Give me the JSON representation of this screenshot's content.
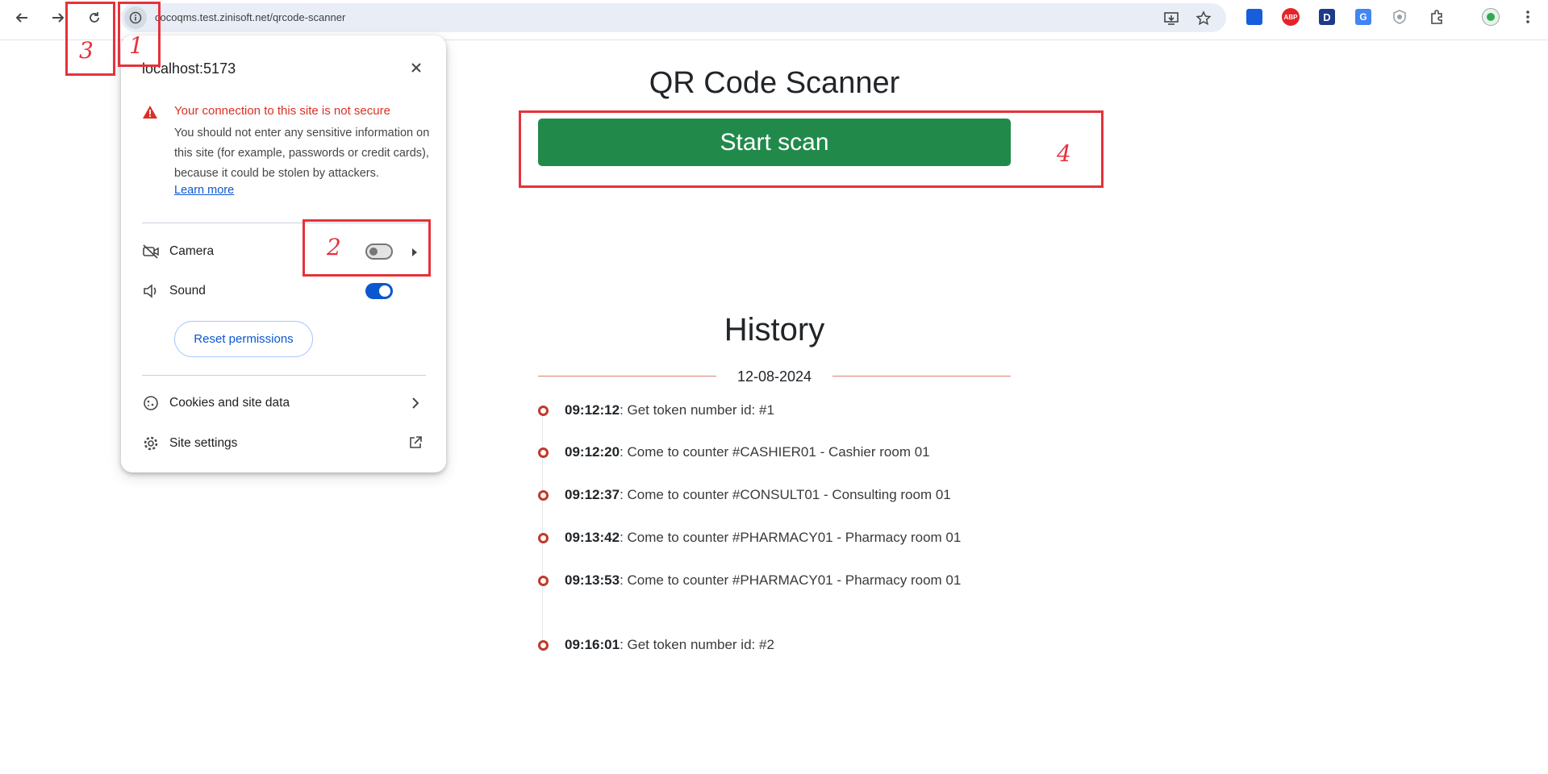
{
  "browser": {
    "url": "cocoqms.test.zinisoft.net/qrcode-scanner",
    "icons": [
      "back-icon",
      "forward-icon",
      "reload-icon",
      "site-info-icon",
      "install-app-icon",
      "bookmark-star-icon",
      "profile-avatar-icon",
      "more-menu-icon"
    ],
    "extensions": [
      {
        "name": "bitwarden-extension-icon",
        "label": "",
        "color": "#175ddc"
      },
      {
        "name": "adblock-plus-extension-icon",
        "label": "ABP",
        "color": "#e4232a"
      },
      {
        "name": "dashlane-extension-icon",
        "label": "D",
        "color": "#1e3a8a"
      },
      {
        "name": "translate-extension-icon",
        "label": "G",
        "color": "#4285f4"
      },
      {
        "name": "shield-extension-icon",
        "label": "",
        "color": "#9aa0a6"
      },
      {
        "name": "extensions-puzzle-icon",
        "label": "",
        "color": "#444746"
      }
    ]
  },
  "annotations": [
    "1",
    "2",
    "3",
    "4"
  ],
  "site_info_popup": {
    "title": "localhost:5173",
    "warning_title": "Your connection to this site is not secure",
    "warning_text": "You should not enter any sensitive information on this site (for example, passwords or credit cards), because it could be stolen by attackers.",
    "learn_more": "Learn more",
    "permissions": [
      {
        "label": "Camera",
        "enabled": false,
        "icon": "camera-off-icon"
      },
      {
        "label": "Sound",
        "enabled": true,
        "icon": "speaker-icon"
      }
    ],
    "reset_button": "Reset permissions",
    "links": [
      {
        "label": "Cookies and site data",
        "icon": "cookie-icon"
      },
      {
        "label": "Site settings",
        "icon": "settings-gear-icon"
      }
    ]
  },
  "page": {
    "title": "QR Code Scanner",
    "scan_button": "Start scan",
    "history_title": "History",
    "history_date": "12-08-2024",
    "history": [
      {
        "time": "09:12:12",
        "text": ": Get token number id: #1"
      },
      {
        "time": "09:12:20",
        "text": ": Come to counter #CASHIER01 - Cashier room 01"
      },
      {
        "time": "09:12:37",
        "text": ": Come to counter #CONSULT01 - Consulting room 01"
      },
      {
        "time": "09:13:42",
        "text": ": Come to counter #PHARMACY01 - Pharmacy room 01"
      },
      {
        "time": "09:13:53",
        "text": ": Come to counter #PHARMACY01 - Pharmacy room 01"
      },
      {
        "time": "09:16:01",
        "text": ": Get token number id: #2"
      }
    ],
    "colors": {
      "scan_button": "#218a4b",
      "timeline_dot": "#c0392b",
      "annotation": "#e5323b"
    }
  }
}
